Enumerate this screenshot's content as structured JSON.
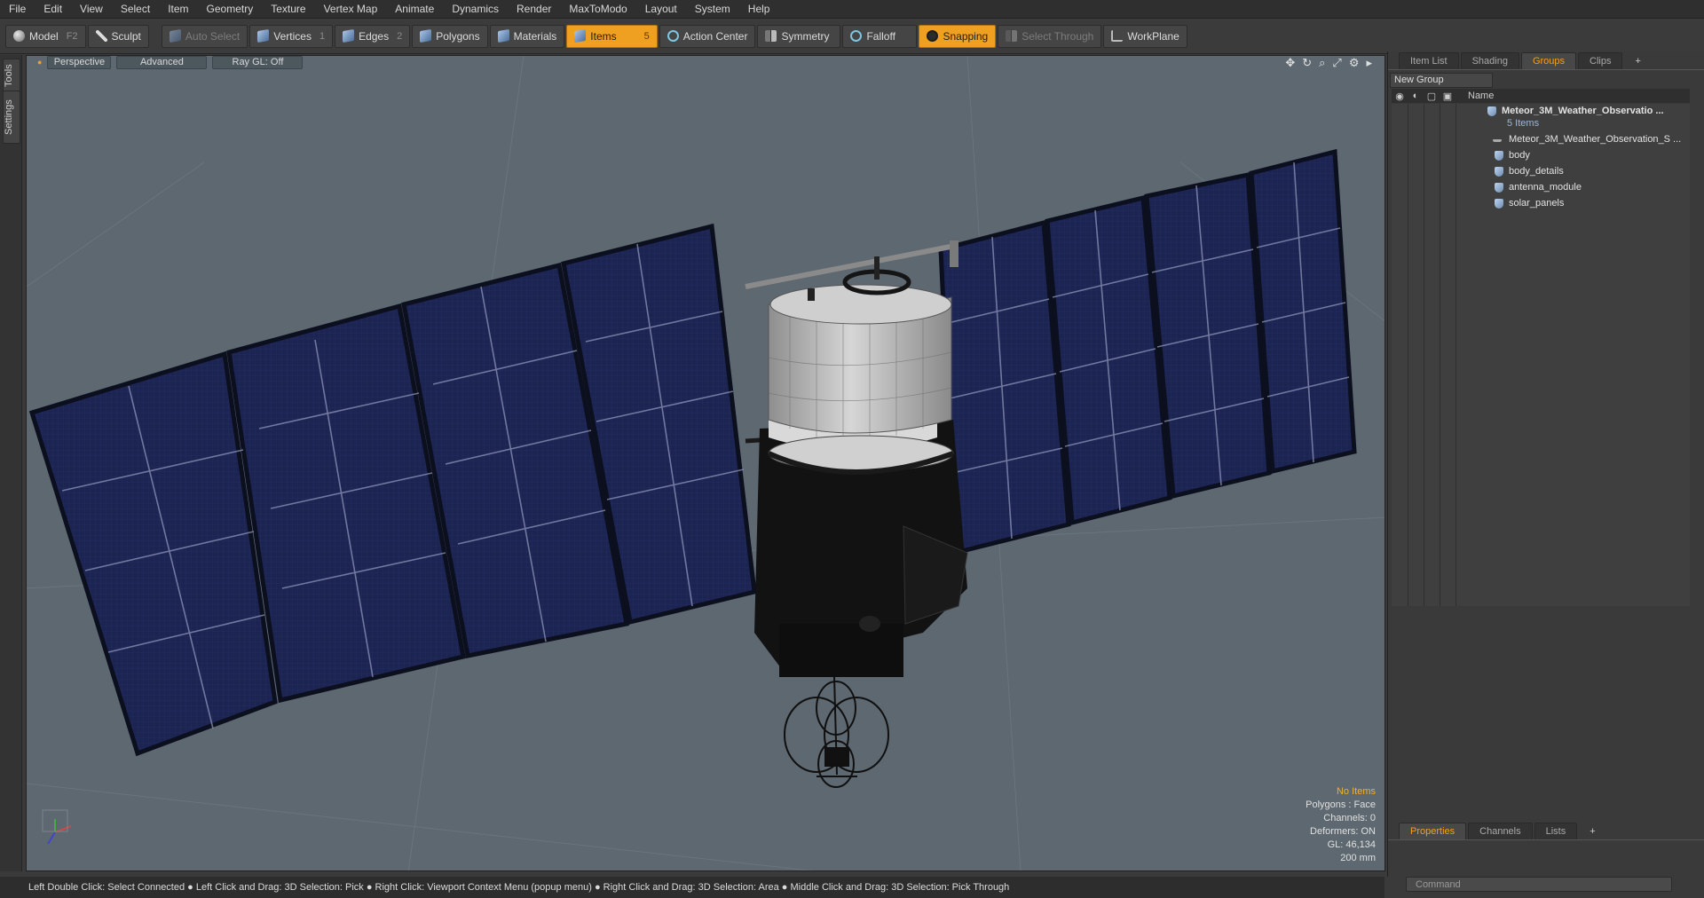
{
  "menu": [
    "File",
    "Edit",
    "View",
    "Select",
    "Item",
    "Geometry",
    "Texture",
    "Vertex Map",
    "Animate",
    "Dynamics",
    "Render",
    "MaxToModo",
    "Layout",
    "System",
    "Help"
  ],
  "toolbar": {
    "model": {
      "label": "Model",
      "key": "F2"
    },
    "sculpt": {
      "label": "Sculpt"
    },
    "auto_select": {
      "label": "Auto Select"
    },
    "vertices": {
      "label": "Vertices",
      "key": "1"
    },
    "edges": {
      "label": "Edges",
      "key": "2"
    },
    "polygons": {
      "label": "Polygons"
    },
    "materials": {
      "label": "Materials"
    },
    "items": {
      "label": "Items",
      "key": "5"
    },
    "action_center": {
      "label": "Action Center"
    },
    "symmetry": {
      "label": "Symmetry"
    },
    "falloff": {
      "label": "Falloff"
    },
    "snapping": {
      "label": "Snapping"
    },
    "select_through": {
      "label": "Select Through"
    },
    "workplane": {
      "label": "WorkPlane"
    }
  },
  "left_tabs": [
    "Tools",
    "Settings"
  ],
  "viewport": {
    "view_mode": "Perspective",
    "shading": "Advanced",
    "raygl": "Ray GL: Off",
    "info": {
      "selection": "No Items",
      "polygons": "Polygons : Face",
      "channels": "Channels: 0",
      "deformers": "Deformers: ON",
      "gl": "GL: 46,134",
      "scale": "200 mm"
    }
  },
  "status": "Left Double Click: Select Connected ● Left Click and Drag: 3D Selection: Pick ● Right Click: Viewport Context Menu (popup menu) ● Right Click and Drag: 3D Selection: Area ● Middle Click and Drag: 3D Selection: Pick Through",
  "right_panel": {
    "tabs": [
      "Item List",
      "Shading",
      "Groups",
      "Clips"
    ],
    "active_tab": "Groups",
    "new_group": "New Group",
    "name_header": "Name",
    "group": {
      "name": "Meteor_3M_Weather_Observatio ...",
      "count": "5 Items"
    },
    "items": [
      "Meteor_3M_Weather_Observation_S ...",
      "body",
      "body_details",
      "antenna_module",
      "solar_panels"
    ],
    "bottom_tabs": [
      "Properties",
      "Channels",
      "Lists"
    ],
    "command_placeholder": "Command"
  },
  "colors": {
    "accent": "#f0a020",
    "viewport_bg": "#5d6870",
    "panel_blue": "#1b2550"
  }
}
